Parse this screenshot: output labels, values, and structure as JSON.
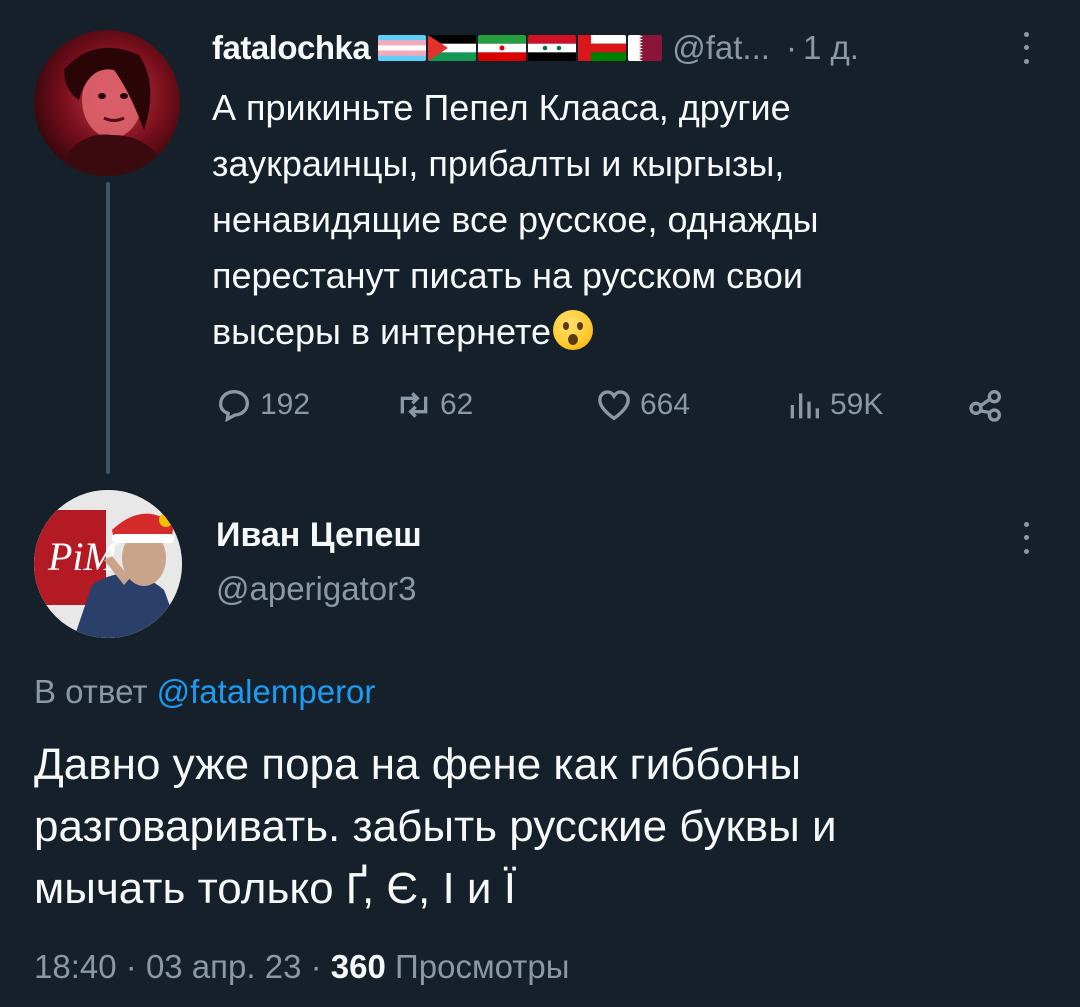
{
  "parent_tweet": {
    "display_name": "fatalochka",
    "handle": "@fat...",
    "separator": "·",
    "time": "1 д.",
    "flags": [
      "trans-flag",
      "palestine-flag",
      "iran-flag",
      "syria-flag",
      "oman-flag",
      "qatar-flag"
    ],
    "text_lines": [
      "А прикиньте Пепел Клааса, другие",
      "заукраинцы, прибалты и кыргызы,",
      "ненавидящие все русское, однажды",
      "перестанут писать на русском свои",
      "высеры в интернете"
    ],
    "emoji": "hushed-face-emoji",
    "replies": "192",
    "retweets": "62",
    "likes": "664",
    "views": "59K"
  },
  "main_tweet": {
    "display_name": "Иван Цепеш",
    "handle": "@aperigator3",
    "reply_prefix": "В ответ",
    "reply_mention": "@fatalemperor",
    "text_lines": [
      "Давно уже пора на фене как гиббоны",
      "разговаривать. забыть русские буквы и",
      "мычать только Ґ, Є, І и Ї"
    ],
    "time": "18:40",
    "date": "03 апр. 23",
    "separator": "·",
    "view_count": "360",
    "views_label": "Просмотры"
  },
  "colors": {
    "background": "#15202b",
    "text": "#f7f9f9",
    "secondary": "#8b98a5",
    "accent": "#1d9bf0"
  }
}
